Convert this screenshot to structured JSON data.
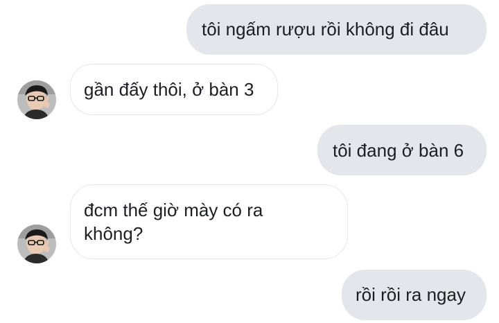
{
  "conversation": {
    "messages": [
      {
        "sender": "me",
        "text": "tôi ngấm rượu rồi không đi đâu"
      },
      {
        "sender": "other",
        "text": "gần đấy thôi, ở bàn 3"
      },
      {
        "sender": "me",
        "text": "tôi đang ở bàn 6"
      },
      {
        "sender": "other",
        "text": "đcm thế giờ mày có ra\nkhông?"
      },
      {
        "sender": "me",
        "text": "rồi rồi ra ngay"
      }
    ]
  },
  "colors": {
    "sent_bubble": "#e4e6eb",
    "received_border": "#e4e6eb",
    "text": "#1c1e21",
    "background": "#ffffff"
  },
  "icons": {
    "avatar": "contact-avatar-icon"
  }
}
